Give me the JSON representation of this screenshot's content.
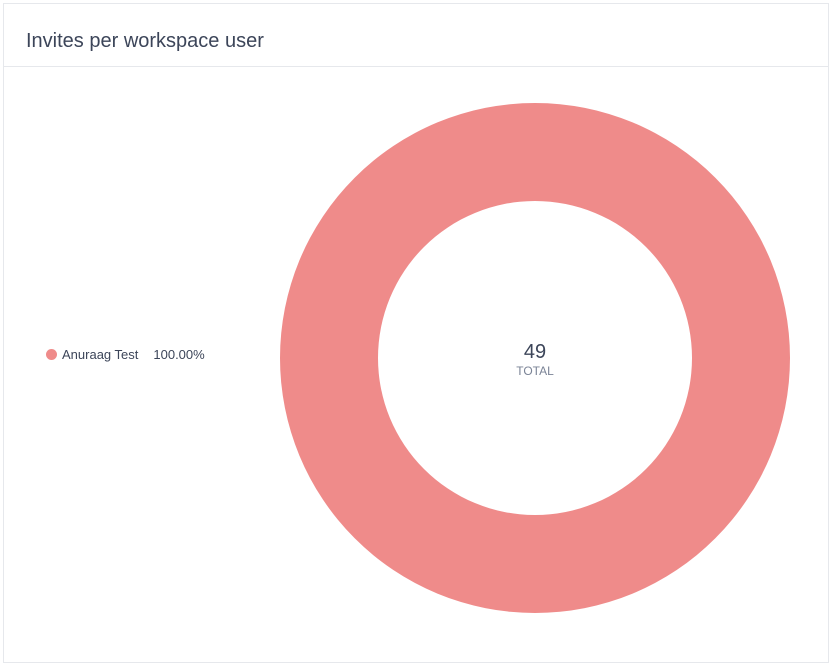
{
  "title": "Invites per workspace user",
  "colors": {
    "slice": "#ef8b8a",
    "text": "#3c4559",
    "muted": "#7a8396"
  },
  "chart_data": {
    "type": "pie",
    "donut": true,
    "title": "Invites per workspace user",
    "total": "49",
    "total_label": "TOTAL",
    "legend_position": "left",
    "slices": [
      {
        "label": "Anuraag Test",
        "value": 49,
        "percent": "100.00%",
        "color": "#ef8b8a"
      }
    ]
  }
}
